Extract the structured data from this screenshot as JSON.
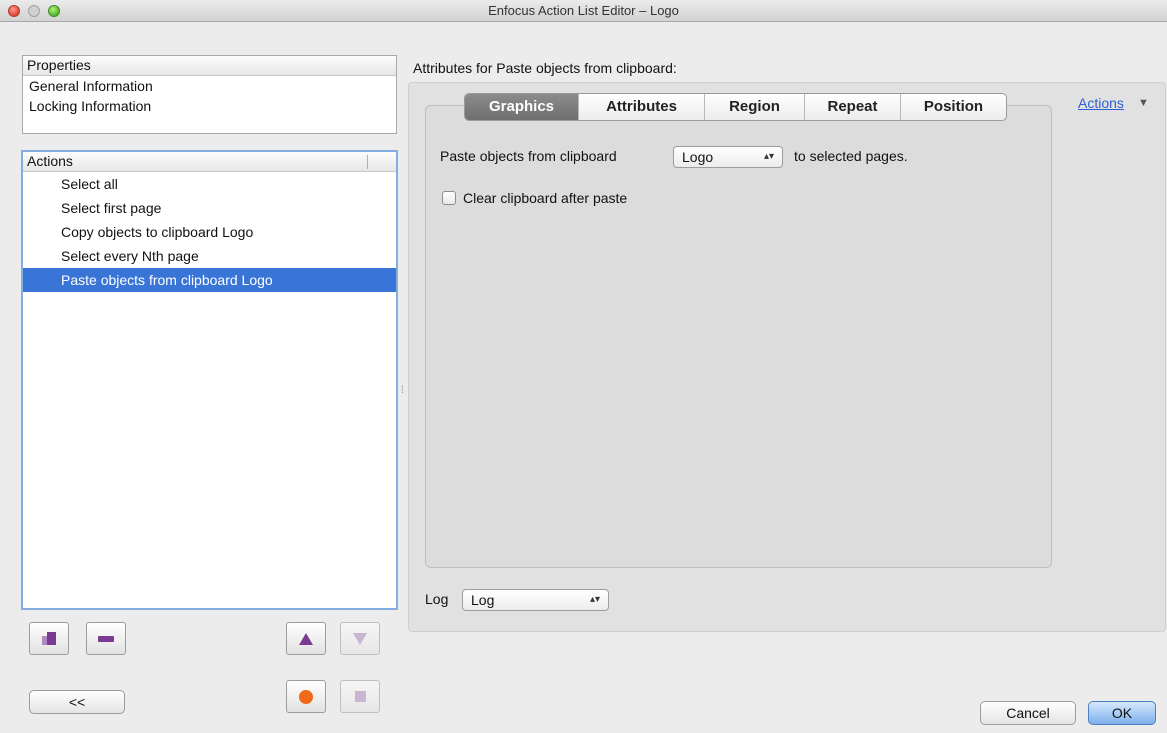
{
  "window": {
    "title": "Enfocus Action List Editor – Logo"
  },
  "properties": {
    "header": "Properties",
    "items": [
      "General Information",
      "Locking Information"
    ]
  },
  "actions_panel": {
    "header": "Actions",
    "items": [
      "Select all",
      "Select first page",
      "Copy objects to clipboard Logo",
      "Select every Nth page",
      "Paste objects from clipboard Logo"
    ],
    "selected_index": 4
  },
  "bottom_left": {
    "collapse_label": "<<"
  },
  "attributes": {
    "title": "Attributes for Paste objects from clipboard:",
    "tabs": [
      "Graphics",
      "Attributes",
      "Region",
      "Repeat",
      "Position"
    ],
    "active_tab": "Graphics",
    "actions_menu_label": "Actions",
    "paste_label": "Paste objects from clipboard",
    "paste_select_value": "Logo",
    "paste_suffix": "to selected pages.",
    "clear_clipboard_label": "Clear clipboard after paste",
    "clear_clipboard_checked": false,
    "log_label": "Log",
    "log_select_value": "Log"
  },
  "footer": {
    "cancel_label": "Cancel",
    "ok_label": "OK"
  },
  "colors": {
    "selection": "#3875d7",
    "accent_purple": "#7a3c92",
    "record_orange": "#f06a1a",
    "link": "#2d5fd0"
  }
}
